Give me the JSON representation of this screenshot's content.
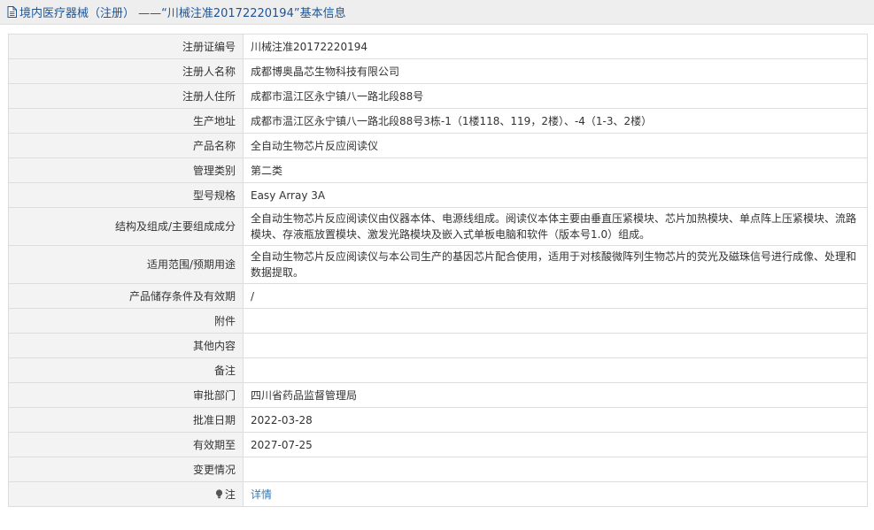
{
  "header": {
    "title": "境内医疗器械（注册）  ——“川械注准20172220194”基本信息",
    "icon": "document-icon"
  },
  "rows": [
    {
      "label": "注册证编号",
      "value": "川械注准20172220194"
    },
    {
      "label": "注册人名称",
      "value": "成都博奥晶芯生物科技有限公司"
    },
    {
      "label": "注册人住所",
      "value": "成都市温江区永宁镇八一路北段88号"
    },
    {
      "label": "生产地址",
      "value": "成都市温江区永宁镇八一路北段88号3栋-1（1楼118、119，2楼）、-4（1-3、2楼）"
    },
    {
      "label": "产品名称",
      "value": "全自动生物芯片反应阅读仪"
    },
    {
      "label": "管理类别",
      "value": "第二类"
    },
    {
      "label": "型号规格",
      "value": "Easy Array 3A"
    },
    {
      "label": "结构及组成/主要组成成分",
      "value": "全自动生物芯片反应阅读仪由仪器本体、电源线组成。阅读仪本体主要由垂直压紧模块、芯片加热模块、单点阵上压紧模块、流路模块、存液瓶放置模块、激发光路模块及嵌入式单板电脑和软件（版本号1.0）组成。"
    },
    {
      "label": "适用范围/预期用途",
      "value": "全自动生物芯片反应阅读仪与本公司生产的基因芯片配合使用，适用于对核酸微阵列生物芯片的荧光及磁珠信号进行成像、处理和数据提取。"
    },
    {
      "label": "产品储存条件及有效期",
      "value": "/"
    },
    {
      "label": "附件",
      "value": ""
    },
    {
      "label": "其他内容",
      "value": ""
    },
    {
      "label": "备注",
      "value": ""
    },
    {
      "label": "审批部门",
      "value": "四川省药品监督管理局"
    },
    {
      "label": "批准日期",
      "value": "2022-03-28"
    },
    {
      "label": "有效期至",
      "value": "2027-07-25"
    },
    {
      "label": "变更情况",
      "value": ""
    }
  ],
  "note_row": {
    "label": "注",
    "icon": "lightbulb-icon",
    "link_text": "详情"
  },
  "colors": {
    "title_text": "#1e5494",
    "title_bg": "#eeeeee",
    "label_bg": "#f3f3f3",
    "border": "#dddddd",
    "link": "#337ab7"
  }
}
